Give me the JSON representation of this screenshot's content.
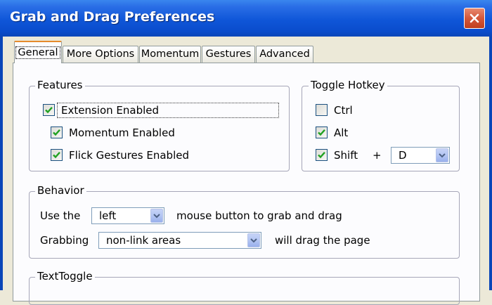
{
  "window": {
    "title": "Grab and Drag Preferences"
  },
  "tabs": [
    {
      "label": "General",
      "active": true
    },
    {
      "label": "More Options",
      "active": false
    },
    {
      "label": "Momentum",
      "active": false
    },
    {
      "label": "Gestures",
      "active": false
    },
    {
      "label": "Advanced",
      "active": false
    }
  ],
  "features": {
    "legend": "Features",
    "extension_enabled": {
      "label": "Extension Enabled",
      "checked": true
    },
    "momentum_enabled": {
      "label": "Momentum Enabled",
      "checked": true
    },
    "flick_gestures_enabled": {
      "label": "Flick Gestures Enabled",
      "checked": true
    }
  },
  "toggle_hotkey": {
    "legend": "Toggle Hotkey",
    "ctrl": {
      "label": "Ctrl",
      "checked": false
    },
    "alt": {
      "label": "Alt",
      "checked": true
    },
    "shift": {
      "label": "Shift",
      "checked": true
    },
    "plus": "+",
    "key": {
      "value": "D"
    }
  },
  "behavior": {
    "legend": "Behavior",
    "use_the": "Use the",
    "mouse_button": {
      "value": "left"
    },
    "mouse_button_suffix": "mouse button to grab and drag",
    "grabbing": "Grabbing",
    "grab_area": {
      "value": "non-link areas"
    },
    "grab_area_suffix": "will drag the page"
  },
  "text_toggle": {
    "legend": "TextToggle"
  },
  "colors": {
    "titlebar": "#0a4ccc",
    "tab_highlight": "#e68b2c",
    "check": "#21a121"
  }
}
